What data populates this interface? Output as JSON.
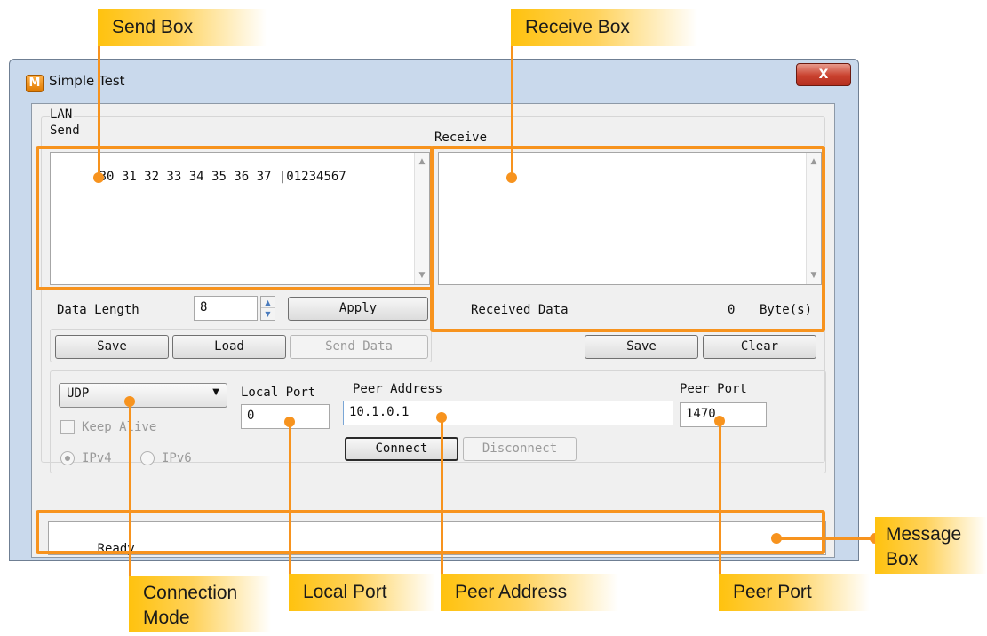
{
  "window": {
    "title": "Simple Test",
    "icon_letter": "M",
    "close_symbol": "X"
  },
  "lan": {
    "group_label": "LAN",
    "send_label": "Send",
    "send_text": "30 31 32 33 34 35 36 37 |01234567",
    "receive_label": "Receive",
    "receive_text": "",
    "data_length_label": "Data Length",
    "data_length_value": "8",
    "apply_label": "Apply",
    "received_data_label": "Received Data",
    "received_count": "0",
    "bytes_unit": "Byte(s)"
  },
  "send_buttons": {
    "save": "Save",
    "load": "Load",
    "send_data": "Send Data"
  },
  "receive_buttons": {
    "save": "Save",
    "clear": "Clear"
  },
  "connection": {
    "mode_value": "UDP",
    "keep_alive_label": "Keep Alive",
    "ipv4_label": "IPv4",
    "ipv6_label": "IPv6",
    "local_port_label": "Local Port",
    "local_port_value": "0",
    "peer_address_label": "Peer Address",
    "peer_address_value": "10.1.0.1",
    "peer_port_label": "Peer Port",
    "peer_port_value": "1470",
    "connect_label": "Connect",
    "disconnect_label": "Disconnect"
  },
  "message_box": {
    "text": "Ready"
  },
  "callouts": {
    "send_box": "Send Box",
    "receive_box": "Receive Box",
    "message_box_line1": "Message",
    "message_box_line2": "Box",
    "connection_mode_line1": "Connection",
    "connection_mode_line2": "Mode",
    "local_port": "Local Port",
    "peer_address": "Peer Address",
    "peer_port": "Peer Port"
  },
  "colors": {
    "callout_orange": "#f7931e",
    "tag_yellow": "#ffc20e",
    "window_frame": "#c9d9ec",
    "client_bg": "#f0f0f0",
    "close_red": "#c9412e"
  }
}
